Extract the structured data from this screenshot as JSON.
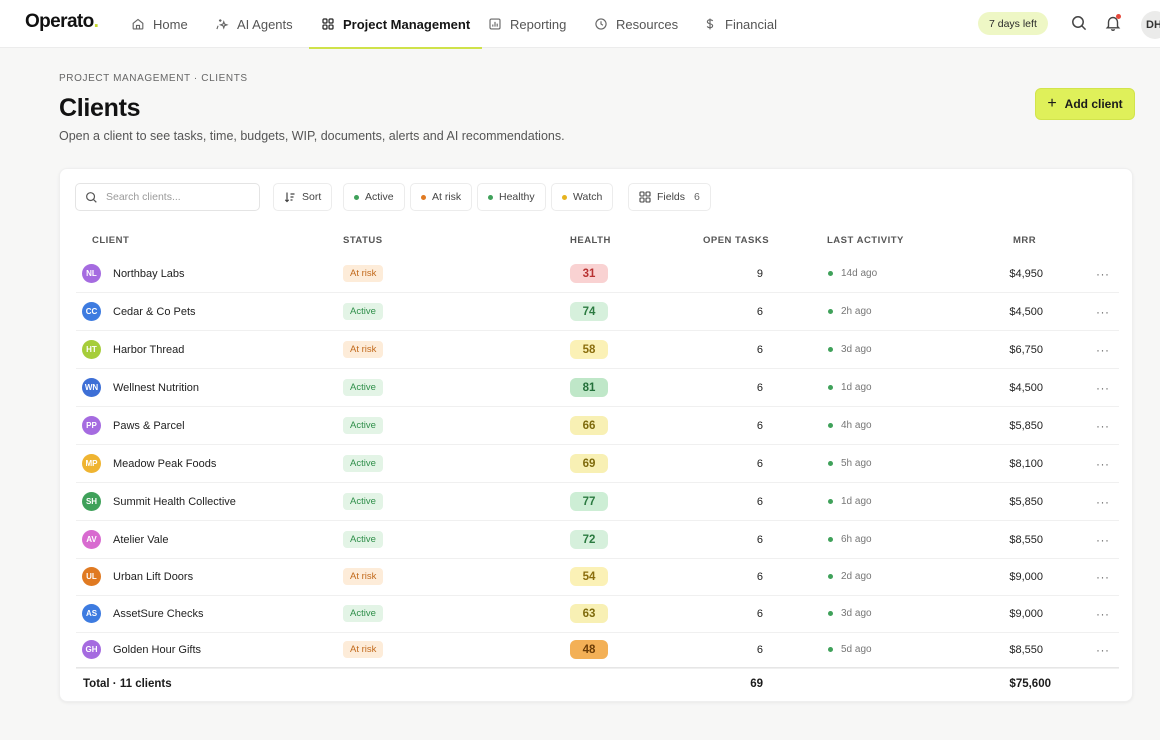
{
  "brand": {
    "name": "Operato",
    "dot": "."
  },
  "nav": [
    {
      "label": "Home",
      "icon": "home-icon"
    },
    {
      "label": "AI Agents",
      "icon": "sparkle-icon"
    },
    {
      "label": "Project Management",
      "icon": "grid-icon",
      "active": true
    },
    {
      "label": "Reporting",
      "icon": "chart-icon"
    },
    {
      "label": "Resources",
      "icon": "clock-icon"
    },
    {
      "label": "Financial",
      "icon": "dollar-icon"
    }
  ],
  "trial_badge": "7 days left",
  "user_initials": "DH",
  "breadcrumb": "PROJECT MANAGEMENT · CLIENTS",
  "page_title": "Clients",
  "subtitle": "Open a client to see tasks, time, budgets, WIP, documents, alerts and AI recommendations.",
  "add_button": {
    "plus": "+",
    "label": "Add client"
  },
  "search": {
    "placeholder": "Search clients..."
  },
  "toolbar": {
    "sort": "Sort",
    "filters": [
      {
        "label": "Active",
        "color": "#3fa15a"
      },
      {
        "label": "At risk",
        "color": "#e07a22"
      },
      {
        "label": "Healthy",
        "color": "#3fa15a"
      },
      {
        "label": "Watch",
        "color": "#e6b31e"
      }
    ],
    "fields_label": "Fields",
    "fields_count": "6"
  },
  "columns": {
    "client": "CLIENT",
    "status": "STATUS",
    "health": "HEALTH",
    "open_tasks": "OPEN TASKS",
    "last_activity": "LAST ACTIVITY",
    "mrr": "MRR"
  },
  "colors": {
    "accent": "#dff05a",
    "status_active_bg": "#e3f4e6",
    "status_active_fg": "#2f8f4a",
    "status_risk_bg": "#fdecd9",
    "status_risk_fg": "#c26a1c"
  },
  "rows": [
    {
      "initials": "NL",
      "avatar_color": "#a56be0",
      "name": "Northbay Labs",
      "status": "At risk",
      "health": "31",
      "health_bg": "#f9d2d2",
      "health_fg": "#b83232",
      "open_tasks": "9",
      "last_activity": "14d ago",
      "mrr": "$4,950"
    },
    {
      "initials": "CC",
      "avatar_color": "#3d7be0",
      "name": "Cedar & Co Pets",
      "status": "Active",
      "health": "74",
      "health_bg": "#d6f0dc",
      "health_fg": "#2b7a40",
      "open_tasks": "6",
      "last_activity": "2h ago",
      "mrr": "$4,500"
    },
    {
      "initials": "HT",
      "avatar_color": "#a6cd3a",
      "name": "Harbor Thread",
      "status": "At risk",
      "health": "58",
      "health_bg": "#fbf1b6",
      "health_fg": "#8a6d0c",
      "open_tasks": "6",
      "last_activity": "3d ago",
      "mrr": "$6,750"
    },
    {
      "initials": "WN",
      "avatar_color": "#3d6fd6",
      "name": "Wellnest Nutrition",
      "status": "Active",
      "health": "81",
      "health_bg": "#bfe7c8",
      "health_fg": "#23703a",
      "open_tasks": "6",
      "last_activity": "1d ago",
      "mrr": "$4,500"
    },
    {
      "initials": "PP",
      "avatar_color": "#a56be0",
      "name": "Paws & Parcel",
      "status": "Active",
      "health": "66",
      "health_bg": "#f8f0b4",
      "health_fg": "#7e6a0c",
      "open_tasks": "6",
      "last_activity": "4h ago",
      "mrr": "$5,850"
    },
    {
      "initials": "MP",
      "avatar_color": "#efb431",
      "name": "Meadow Peak Foods",
      "status": "Active",
      "health": "69",
      "health_bg": "#f8f0b4",
      "health_fg": "#7e6a0c",
      "open_tasks": "6",
      "last_activity": "5h ago",
      "mrr": "$8,100"
    },
    {
      "initials": "SH",
      "avatar_color": "#3fa15a",
      "name": "Summit Health Collective",
      "status": "Active",
      "health": "77",
      "health_bg": "#cdeed5",
      "health_fg": "#2b7a40",
      "open_tasks": "6",
      "last_activity": "1d ago",
      "mrr": "$5,850"
    },
    {
      "initials": "AV",
      "avatar_color": "#d86bd0",
      "name": "Atelier Vale",
      "status": "Active",
      "health": "72",
      "health_bg": "#d6f0dc",
      "health_fg": "#2b7a40",
      "open_tasks": "6",
      "last_activity": "6h ago",
      "mrr": "$8,550"
    },
    {
      "initials": "UL",
      "avatar_color": "#e07a22",
      "name": "Urban Lift Doors",
      "status": "At risk",
      "health": "54",
      "health_bg": "#fbf1b6",
      "health_fg": "#8a6d0c",
      "open_tasks": "6",
      "last_activity": "2d ago",
      "mrr": "$9,000"
    },
    {
      "initials": "AS",
      "avatar_color": "#3d7be0",
      "name": "AssetSure Checks",
      "status": "Active",
      "health": "63",
      "health_bg": "#f8f0b4",
      "health_fg": "#7e6a0c",
      "open_tasks": "6",
      "last_activity": "3d ago",
      "mrr": "$9,000"
    },
    {
      "initials": "GH",
      "avatar_color": "#a56be0",
      "name": "Golden Hour Gifts",
      "status": "At risk",
      "health": "48",
      "health_bg": "#f3b056",
      "health_fg": "#6b3c06",
      "open_tasks": "6",
      "last_activity": "5d ago",
      "mrr": "$8,550"
    }
  ],
  "row_menu": "···",
  "footer": {
    "total_label": "Total · 11 clients",
    "open_tasks_total": "69",
    "mrr_total": "$75,600"
  }
}
